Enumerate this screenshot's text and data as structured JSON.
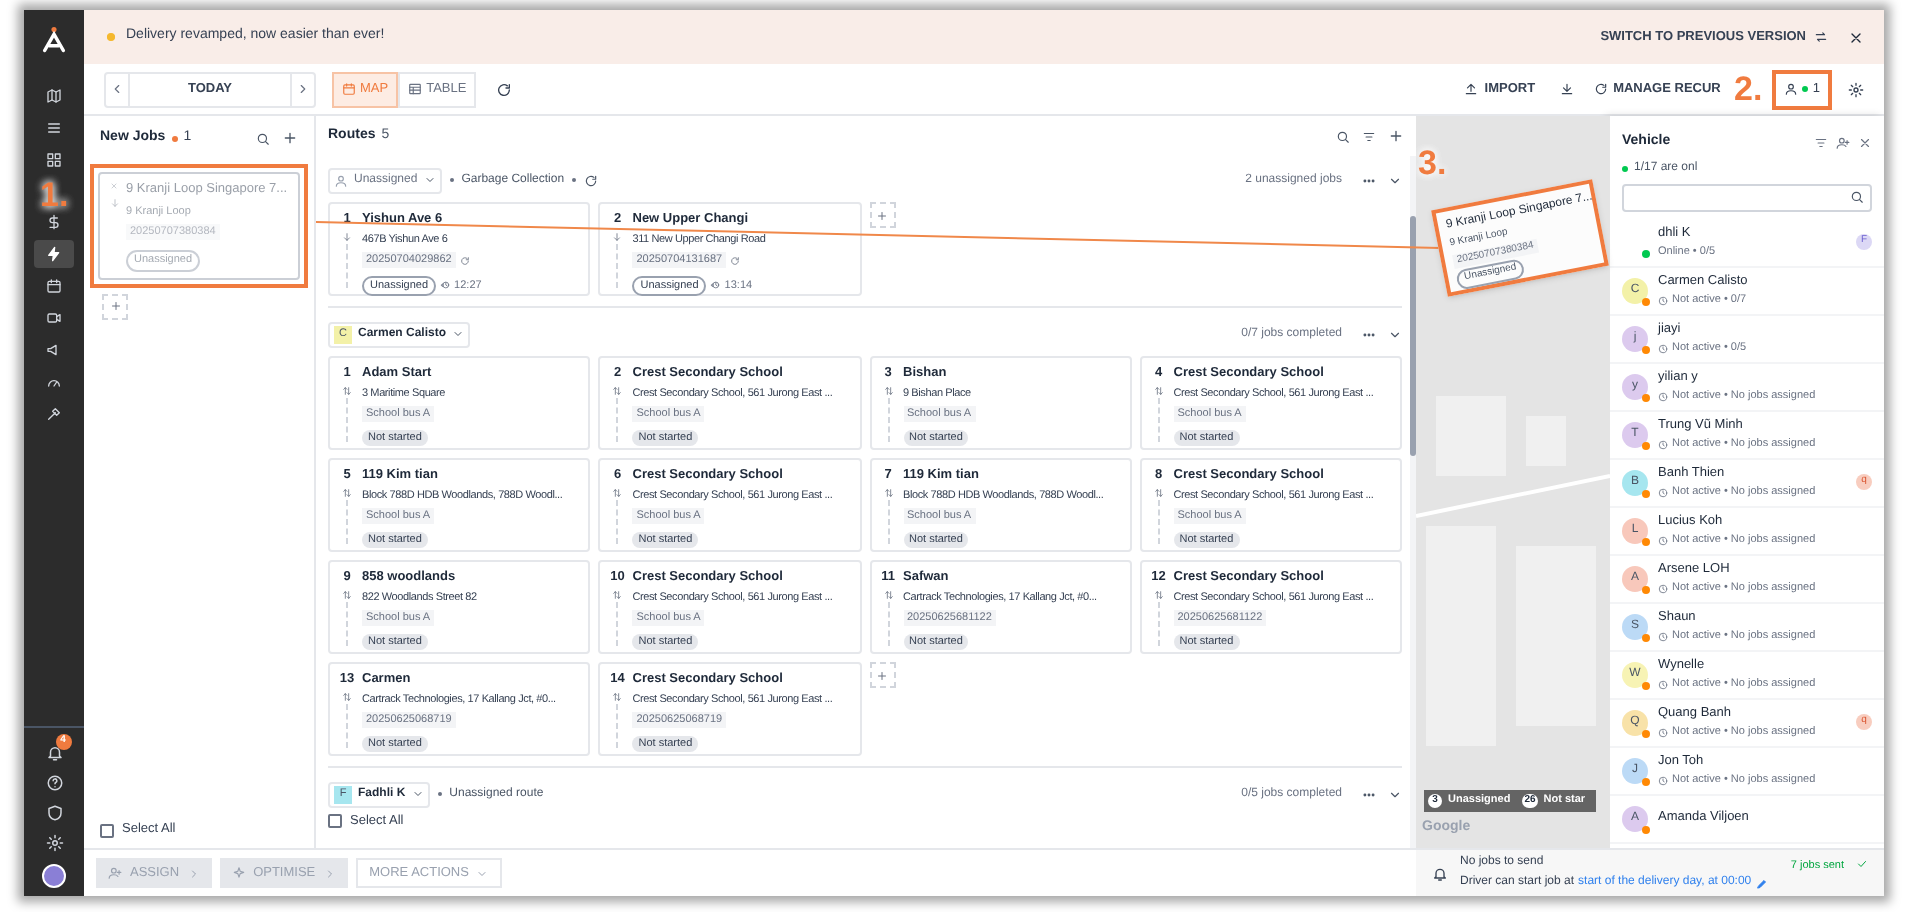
{
  "banner": {
    "text": "Delivery revamped, now easier than ever!",
    "switch_label": "SWITCH TO PREVIOUS VERSION"
  },
  "sidebar": {
    "items": [
      {
        "selected": false
      },
      {
        "selected": false
      },
      {
        "selected": false
      },
      {
        "selected": false
      },
      {
        "selected": true
      },
      {
        "selected": false
      },
      {
        "selected": false
      },
      {
        "selected": false
      },
      {
        "selected": false
      },
      {
        "selected": false
      }
    ],
    "notification_count": "4"
  },
  "toolbar": {
    "date_label": "TODAY",
    "views": [
      {
        "label": "MAP",
        "selected": true
      },
      {
        "label": "TABLE",
        "selected": false
      }
    ],
    "import_label": "IMPORT",
    "recurring_label": "MANAGE RECUR",
    "online_count": "1"
  },
  "new_jobs": {
    "title": "New Jobs",
    "count": "1",
    "jobs": [
      {
        "title": "9 Kranji Loop Singapore 7...",
        "address": "9 Kranji Loop",
        "job_id": "20250707380384",
        "status": "Unassigned",
        "dragging": true
      }
    ],
    "select_all": {
      "label": "Select All",
      "checked": false
    }
  },
  "routes": {
    "title": "Routes",
    "count": "5",
    "groups": [
      {
        "kind": "unassigned",
        "driver": "Unassigned",
        "label": "Garbage Collection",
        "recurring": true,
        "summary": "2 unassigned jobs",
        "cards": [
          {
            "number": "1",
            "title": "Yishun Ave 6",
            "address": "467B Yishun Ave 6",
            "tag": "20250704029862",
            "status": "Unassigned",
            "time": "12:27"
          },
          {
            "number": "2",
            "title": "New Upper Changi",
            "address": "311 New Upper Changi Road",
            "tag": "20250704131687",
            "status": "Unassigned",
            "time": "13:14"
          }
        ]
      },
      {
        "kind": "driver",
        "driver": "Carmen Calisto",
        "avatar": "C",
        "color": "#f3f1a8",
        "recurring": false,
        "summary": "0/7 jobs completed",
        "cards": [
          {
            "number": "1",
            "title": "Adam Start",
            "address": "3 Maritime Square",
            "tag": "School bus A",
            "status": "Not started"
          },
          {
            "number": "2",
            "title": "Crest Secondary School",
            "address": "Crest Secondary School, 561 Jurong East ...",
            "tag": "School bus A",
            "status": "Not started"
          },
          {
            "number": "3",
            "title": "Bishan",
            "address": "9 Bishan Place",
            "tag": "School bus A",
            "status": "Not started"
          },
          {
            "number": "4",
            "title": "Crest Secondary School",
            "address": "Crest Secondary School, 561 Jurong East ...",
            "tag": "School bus A",
            "status": "Not started"
          },
          {
            "number": "5",
            "title": "119 Kim tian",
            "address": "Block 788D HDB Woodlands, 788D Woodl...",
            "tag": "School bus A",
            "status": "Not started"
          },
          {
            "number": "6",
            "title": "Crest Secondary School",
            "address": "Crest Secondary School, 561 Jurong East ...",
            "tag": "School bus A",
            "status": "Not started"
          },
          {
            "number": "7",
            "title": "119 Kim tian",
            "address": "Block 788D HDB Woodlands, 788D Woodl...",
            "tag": "School bus A",
            "status": "Not started"
          },
          {
            "number": "8",
            "title": "Crest Secondary School",
            "address": "Crest Secondary School, 561 Jurong East ...",
            "tag": "School bus A",
            "status": "Not started"
          },
          {
            "number": "9",
            "title": "858 woodlands",
            "address": "822 Woodlands Street 82",
            "tag": "School bus A",
            "status": "Not started"
          },
          {
            "number": "10",
            "title": "Crest Secondary School",
            "address": "Crest Secondary School, 561 Jurong East ...",
            "tag": "School bus A",
            "status": "Not started"
          },
          {
            "number": "11",
            "title": "Safwan",
            "address": "Cartrack Technologies, 17 Kallang Jct, #0...",
            "tag": "20250625681122",
            "status": "Not started"
          },
          {
            "number": "12",
            "title": "Crest Secondary School",
            "address": "Crest Secondary School, 561 Jurong East ...",
            "tag": "20250625681122",
            "status": "Not started"
          },
          {
            "number": "13",
            "title": "Carmen",
            "address": "Cartrack Technologies, 17 Kallang Jct, #0...",
            "tag": "20250625068719",
            "status": "Not started"
          },
          {
            "number": "14",
            "title": "Crest Secondary School",
            "address": "Crest Secondary School, 561 Jurong East ...",
            "tag": "20250625068719",
            "status": "Not started"
          }
        ]
      },
      {
        "kind": "driver",
        "driver": "Fadhli K",
        "avatar": "F",
        "color": "#a6e6ef",
        "label": "Unassigned route",
        "recurring": false,
        "summary": "0/5 jobs completed"
      }
    ],
    "select_all": {
      "label": "Select All",
      "checked": false
    }
  },
  "map": {
    "legend": [
      {
        "count": "3",
        "label": "Unassigned"
      },
      {
        "count": "26",
        "label": "Not star"
      }
    ],
    "attribution": "Google"
  },
  "vehicle_panel": {
    "title": "Vehicle",
    "online_summary": "1/17 are onl",
    "vehicles": [
      {
        "name": "dhli K",
        "status": "Online • 0/5",
        "online": true,
        "badge": "F"
      },
      {
        "name": "Carmen Calisto",
        "status": "Not active • 0/7",
        "online": false,
        "avatar": "C",
        "color": "#f3f1a8"
      },
      {
        "name": "jiayi",
        "status": "Not active • 0/5",
        "online": false,
        "avatar": "j",
        "color": "#dccaee"
      },
      {
        "name": "yilian y",
        "status": "Not active • No jobs assigned",
        "online": false,
        "avatar": "y",
        "color": "#dccaee"
      },
      {
        "name": "Trung Vũ Minh",
        "status": "Not active • No jobs assigned",
        "online": false,
        "avatar": "T",
        "color": "#dccaee"
      },
      {
        "name": "Banh Thien",
        "status": "Not active • No jobs assigned",
        "online": false,
        "avatar": "B",
        "color": "#a6e6ef",
        "badge": "q"
      },
      {
        "name": "Lucius Koh",
        "status": "Not active • No jobs assigned",
        "online": false,
        "avatar": "L",
        "color": "#f8c8bb"
      },
      {
        "name": "Arsene LOH",
        "status": "Not active • No jobs assigned",
        "online": false,
        "avatar": "A",
        "color": "#f8c8bb"
      },
      {
        "name": "Shaun",
        "status": "Not active • No jobs assigned",
        "online": false,
        "avatar": "S",
        "color": "#bcdaf6"
      },
      {
        "name": "Wynelle",
        "status": "Not active • No jobs assigned",
        "online": false,
        "avatar": "W",
        "color": "#f7f3b4"
      },
      {
        "name": "Quang Banh",
        "status": "Not active • No jobs assigned",
        "online": false,
        "avatar": "Q",
        "color": "#f8e2a8",
        "badge": "q"
      },
      {
        "name": "Jon Toh",
        "status": "Not active • No jobs assigned",
        "online": false,
        "avatar": "J",
        "color": "#bcdaf6"
      },
      {
        "name": "Amanda Viljoen",
        "online": false,
        "avatar": "A",
        "color": "#dccaee"
      }
    ]
  },
  "notification": {
    "title": "No jobs to send",
    "text": "Driver can start job at",
    "link": "start of the delivery day, at 00:00",
    "sent": "7 jobs sent"
  },
  "bottom_actions": [
    {
      "label": "ASSIGN",
      "disabled": true
    },
    {
      "label": "OPTIMISE",
      "disabled": true
    },
    {
      "label": "MORE ACTIONS",
      "disabled": true
    }
  ],
  "annotations": [
    {
      "label": "1."
    },
    {
      "label": "2."
    },
    {
      "label": "3."
    }
  ],
  "drag_preview": {
    "title": "9 Kranji Loop Singapore 7...",
    "address": "9 Kranji Loop",
    "job_id": "20250707380384",
    "status": "Unassigned"
  }
}
